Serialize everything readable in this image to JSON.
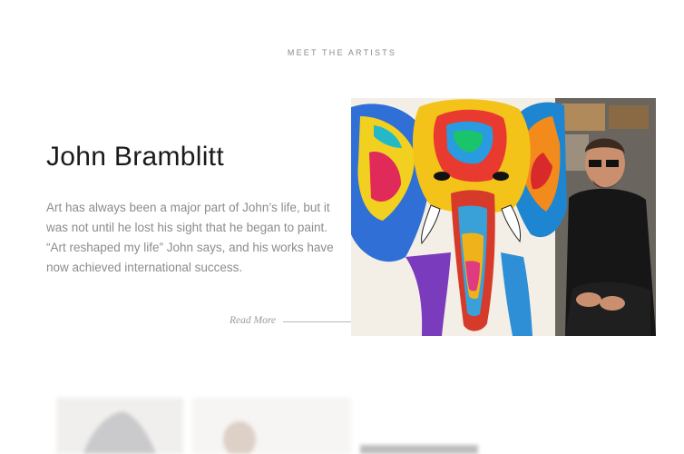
{
  "section": {
    "eyebrow": "MEET THE ARTISTS"
  },
  "featured_artist": {
    "name": "John Bramblitt",
    "bio": "Art has always been a major part of John’s life, but it was not until he lost his sight that he began to paint. “Art reshaped my life” John says, and his works have now achieved international success.",
    "read_more_label": "Read More",
    "image_alt": "John Bramblitt seated beside his colorful elephant painting"
  },
  "colors": {
    "heading": "#1a1a1a",
    "body_text": "#8c8c8c",
    "eyebrow": "#8a8a8a",
    "rule": "#b9b9b9"
  },
  "icons": {
    "read_more_arrow": "arrow-line-icon"
  }
}
